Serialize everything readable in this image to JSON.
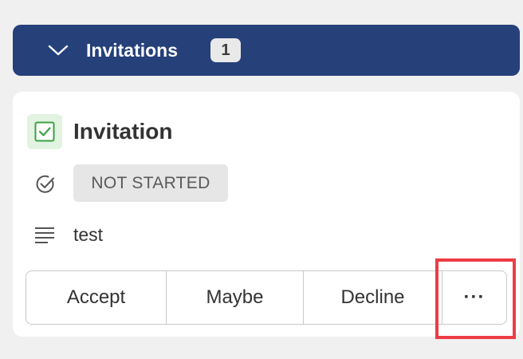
{
  "section": {
    "title": "Invitations",
    "count": "1",
    "chevron_icon": "chevron-down-icon"
  },
  "card": {
    "title": "Invitation",
    "task_icon": "checkbox-checked-icon",
    "status_icon": "circle-check-icon",
    "status": "NOT STARTED",
    "notes_icon": "lines-icon",
    "notes": "test"
  },
  "actions": {
    "accept_label": "Accept",
    "maybe_label": "Maybe",
    "decline_label": "Decline",
    "more_label": "···"
  },
  "colors": {
    "header_bg": "#26407a",
    "highlight": "#ee3c45",
    "check_green": "#3aa241"
  }
}
